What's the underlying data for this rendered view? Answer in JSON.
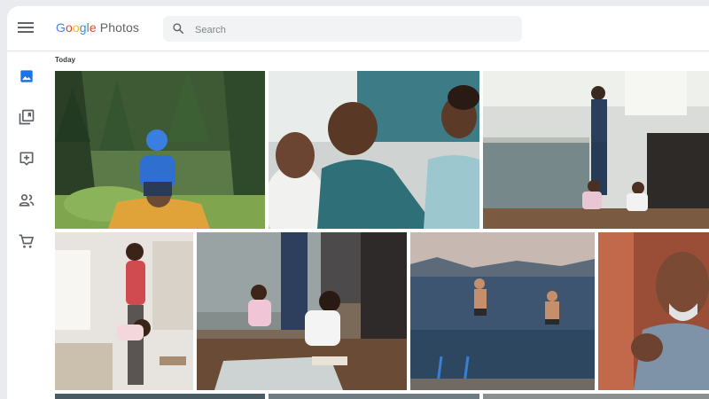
{
  "app": {
    "logo_letters": [
      "G",
      "o",
      "o",
      "g",
      "l",
      "e"
    ],
    "logo_product": "Photos"
  },
  "search": {
    "placeholder": "Search",
    "value": ""
  },
  "sidebar": {
    "items": [
      {
        "icon": "photos-icon",
        "active": true
      },
      {
        "icon": "albums-icon"
      },
      {
        "icon": "assistant-icon"
      },
      {
        "icon": "sharing-icon"
      },
      {
        "icon": "print-store-icon"
      }
    ]
  },
  "gallery": {
    "section_label": "Today",
    "photos": [
      {
        "subject": "child on shoulders in forest"
      },
      {
        "subject": "family laughing on couch"
      },
      {
        "subject": "kitchen with father and kids"
      },
      {
        "subject": "mother playing with daughter"
      },
      {
        "subject": "kids playing on kitchen floor"
      },
      {
        "subject": "boys jumping into lake"
      },
      {
        "subject": "man laughing"
      }
    ]
  },
  "colors": {
    "accent": "#1a73e8",
    "icon_grey": "#5f6368",
    "search_bg": "#f1f3f4"
  }
}
